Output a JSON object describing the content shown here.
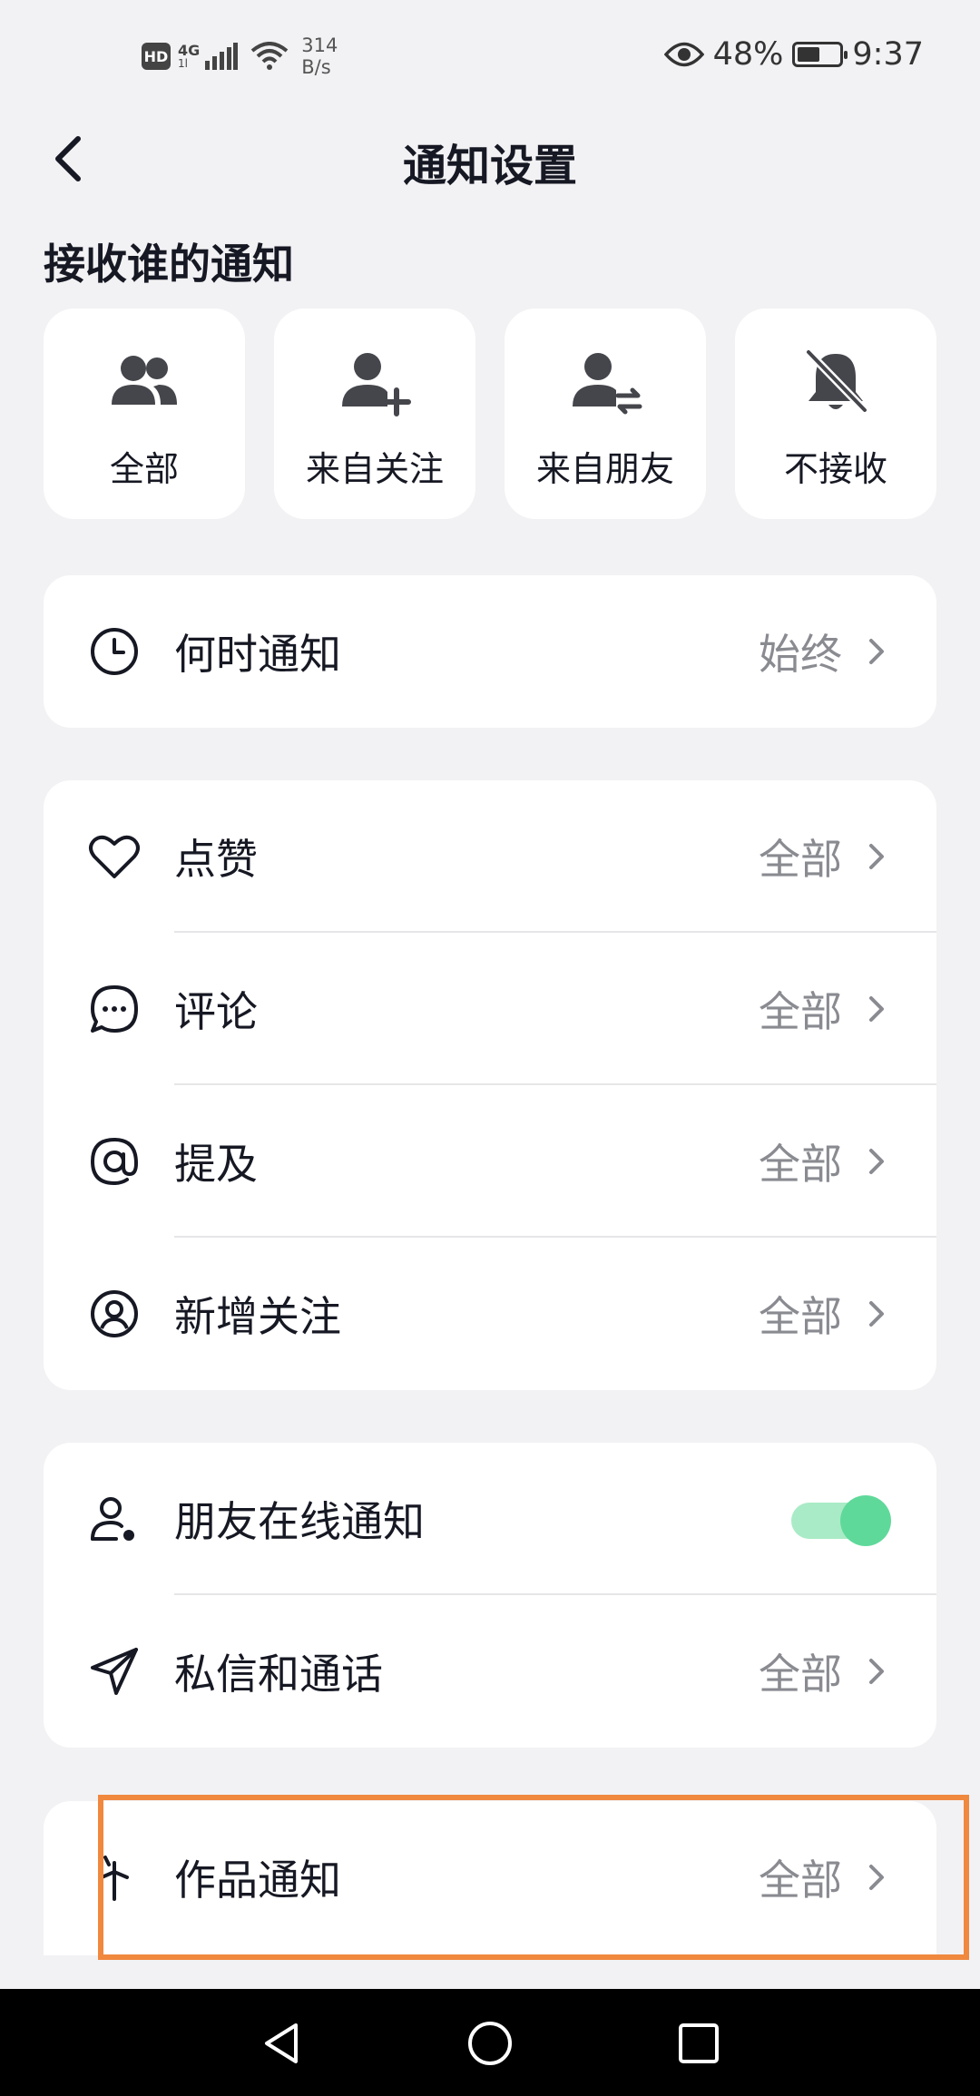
{
  "status_bar": {
    "hd": "HD",
    "network": "4G",
    "network_sub": "1l",
    "speed_value": "314",
    "speed_unit": "B/s",
    "battery": "48%",
    "time": "9:37",
    "icons": [
      "signal-icon",
      "wifi-icon",
      "eye-icon",
      "battery-icon"
    ]
  },
  "header": {
    "title": "通知设置",
    "back_icon": "chevron-left-icon"
  },
  "receive_section": {
    "title": "接收谁的通知",
    "options": [
      {
        "label": "全部",
        "icon": "users-icon"
      },
      {
        "label": "来自关注",
        "icon": "user-add-icon"
      },
      {
        "label": "来自朋友",
        "icon": "user-swap-icon"
      },
      {
        "label": "不接收",
        "icon": "bell-off-icon"
      }
    ]
  },
  "when_card": {
    "rows": [
      {
        "label": "何时通知",
        "value": "始终",
        "icon": "clock-icon"
      }
    ]
  },
  "interaction_card": {
    "rows": [
      {
        "label": "点赞",
        "value": "全部",
        "icon": "heart-icon"
      },
      {
        "label": "评论",
        "value": "全部",
        "icon": "comment-icon"
      },
      {
        "label": "提及",
        "value": "全部",
        "icon": "at-icon"
      },
      {
        "label": "新增关注",
        "value": "全部",
        "icon": "user-circle-icon"
      }
    ]
  },
  "friends_card": {
    "rows": [
      {
        "label": "朋友在线通知",
        "icon": "user-online-icon",
        "toggle_on": true
      },
      {
        "label": "私信和通话",
        "value": "全部",
        "icon": "send-icon"
      }
    ]
  },
  "works_card": {
    "rows": [
      {
        "label": "作品通知",
        "value": "全部",
        "icon": "sparkle-icon"
      }
    ]
  },
  "colors": {
    "background": "#f2f2f4",
    "card": "#ffffff",
    "toggle_on": "#5fd99a",
    "highlight": "#f0883e"
  },
  "nav_bar": {
    "icons": [
      "nav-back-icon",
      "nav-home-icon",
      "nav-recents-icon"
    ]
  }
}
